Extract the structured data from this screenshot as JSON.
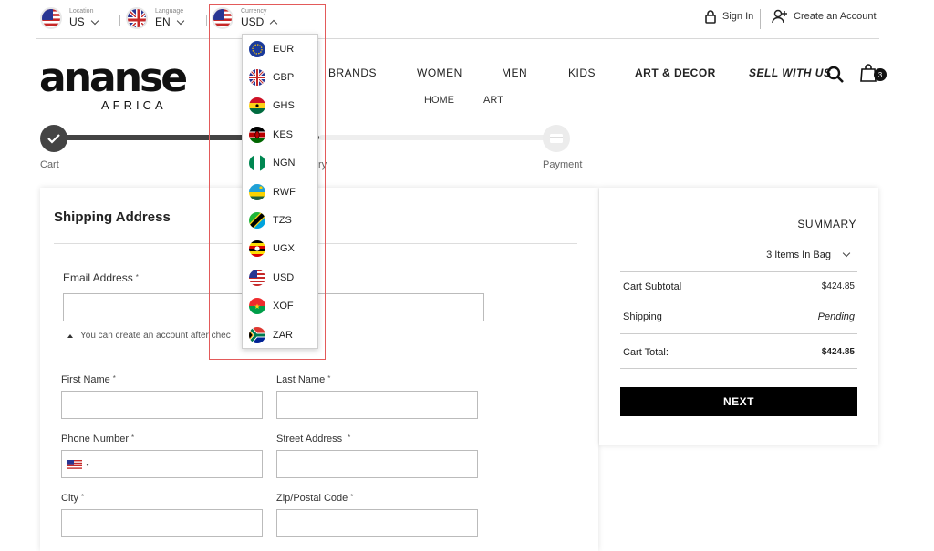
{
  "topbar": {
    "location": {
      "label": "Location",
      "value": "US"
    },
    "language": {
      "label": "Language",
      "value": "EN"
    },
    "currency": {
      "label": "Currency",
      "value": "USD"
    },
    "sign_in": "Sign In",
    "create_account": "Create an Account"
  },
  "logo": {
    "main": "ananse",
    "sub": "AFRICA"
  },
  "nav": {
    "brands": "BRANDS",
    "women": "WOMEN",
    "men": "MEN",
    "kids": "KIDS",
    "art_decor": "ART & DECOR",
    "sell_with_us": "SELL WITH US",
    "cart_count": "3",
    "sub_home": "HOME",
    "sub_art": "ART"
  },
  "progress": {
    "steps": [
      "Cart",
      "ry",
      "Payment"
    ]
  },
  "form": {
    "title": "Shipping Address",
    "email_label": "Email Address",
    "account_note": "You can create an account after chec",
    "first_name_label": "First Name",
    "last_name_label": "Last Name",
    "phone_label": "Phone Number",
    "street_label": "Street Address",
    "city_label": "City",
    "zip_label": "Zip/Postal Code",
    "required_mark": "*"
  },
  "summary": {
    "title": "SUMMARY",
    "items_in_bag": "3 Items In Bag",
    "subtotal_label": "Cart Subtotal",
    "subtotal_value": "$424.85",
    "shipping_label": "Shipping",
    "shipping_value": "Pending",
    "total_label": "Cart Total:",
    "total_value": "$424.85",
    "next_button": "NEXT"
  },
  "currency_dropdown": {
    "options": [
      "EUR",
      "GBP",
      "GHS",
      "KES",
      "NGN",
      "RWF",
      "TZS",
      "UGX",
      "USD",
      "XOF",
      "ZAR"
    ]
  },
  "colors": {
    "highlight": "#e35a5a",
    "progress_done": "#444444",
    "progress_todo": "#eeeeee",
    "button": "#000000"
  }
}
